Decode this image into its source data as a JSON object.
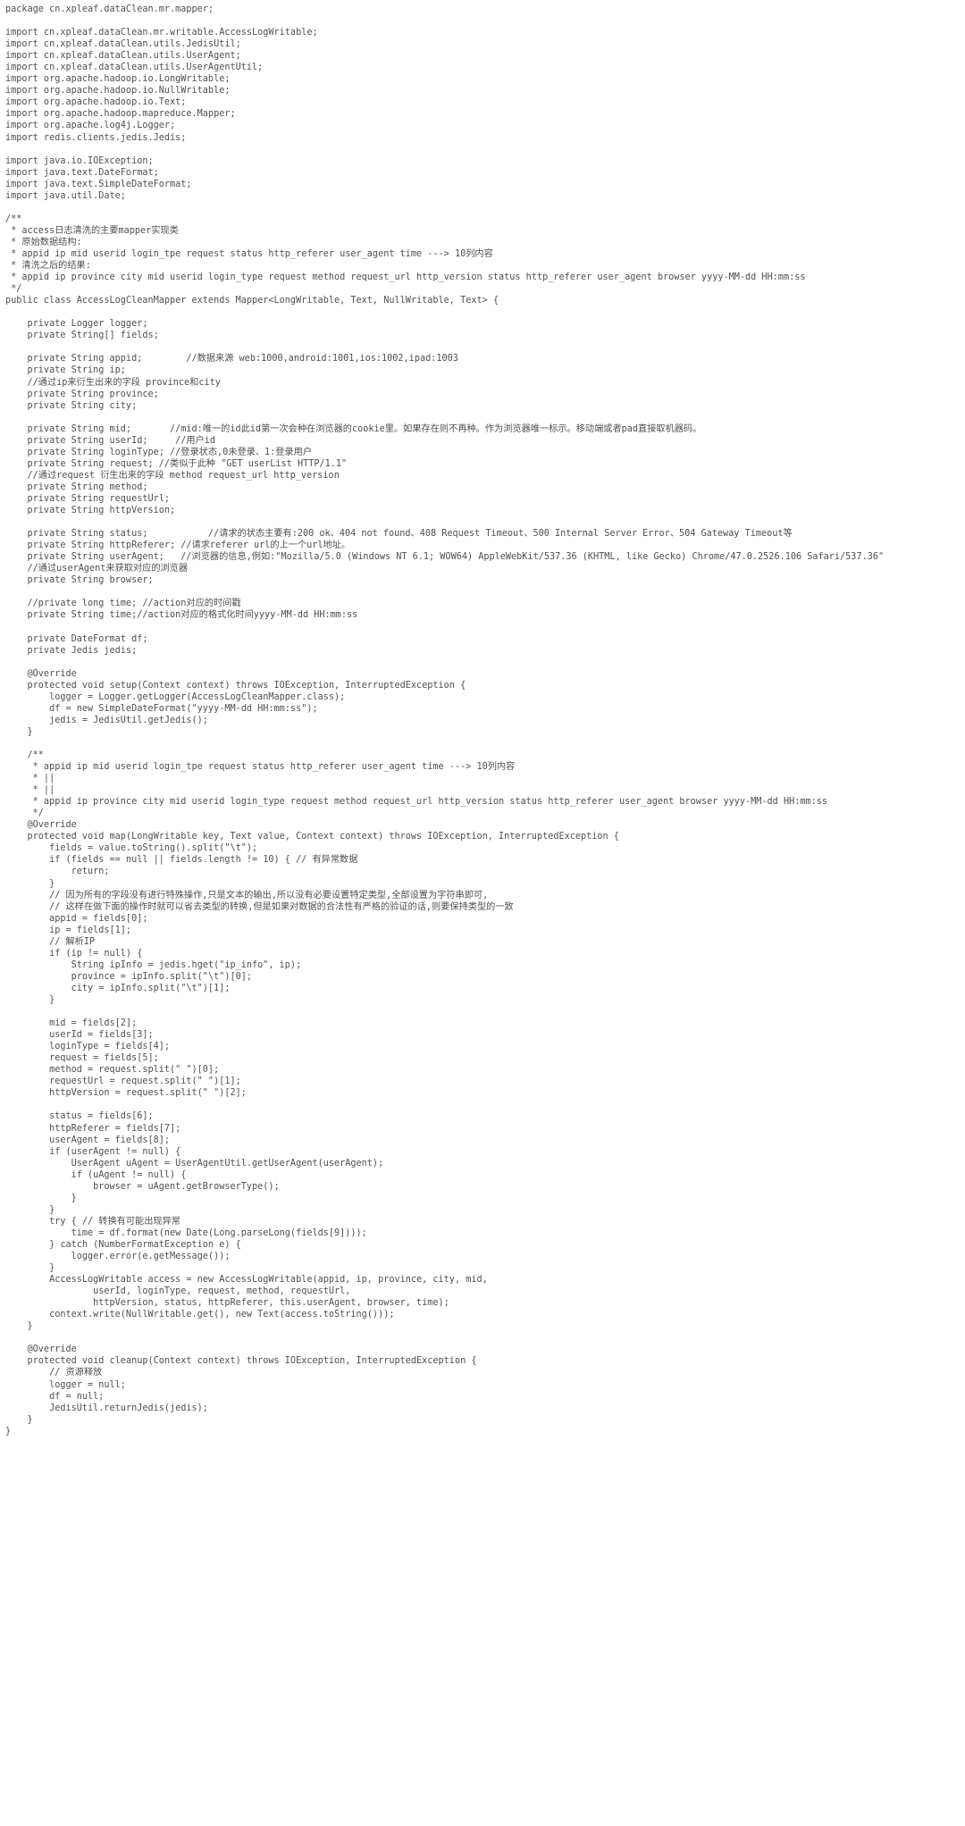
{
  "document": {
    "language": "java",
    "class_name": "AccessLogCleanMapper",
    "package": "cn.xpleaf.dataClean.mr.mapper",
    "background_color": "#ffffff",
    "text_color": "#4f4f4f"
  },
  "code": {
    "lines": [
      "package cn.xpleaf.dataClean.mr.mapper;",
      "",
      "import cn.xpleaf.dataClean.mr.writable.AccessLogWritable;",
      "import cn.xpleaf.dataClean.utils.JedisUtil;",
      "import cn.xpleaf.dataClean.utils.UserAgent;",
      "import cn.xpleaf.dataClean.utils.UserAgentUtil;",
      "import org.apache.hadoop.io.LongWritable;",
      "import org.apache.hadoop.io.NullWritable;",
      "import org.apache.hadoop.io.Text;",
      "import org.apache.hadoop.mapreduce.Mapper;",
      "import org.apache.log4j.Logger;",
      "import redis.clients.jedis.Jedis;",
      "",
      "import java.io.IOException;",
      "import java.text.DateFormat;",
      "import java.text.SimpleDateFormat;",
      "import java.util.Date;",
      "",
      "/**",
      " * access日志清洗的主要mapper实现类",
      " * 原始数据结构:",
      " * appid ip mid userid login_tpe request status http_referer user_agent time ---> 10列内容",
      " * 清洗之后的结果:",
      " * appid ip province city mid userid login_type request method request_url http_version status http_referer user_agent browser yyyy-MM-dd HH:mm:ss",
      " */",
      "public class AccessLogCleanMapper extends Mapper<LongWritable, Text, NullWritable, Text> {",
      "",
      "    private Logger logger;",
      "    private String[] fields;",
      "",
      "    private String appid;        //数据来源 web:1000,android:1001,ios:1002,ipad:1003",
      "    private String ip;",
      "    //通过ip来衍生出来的字段 province和city",
      "    private String province;",
      "    private String city;",
      "",
      "    private String mid;       //mid:唯一的id此id第一次会种在浏览器的cookie里。如果存在则不再种。作为浏览器唯一标示。移动端或者pad直接取机器码。",
      "    private String userId;     //用户id",
      "    private String loginType; //登录状态,0未登录、1:登录用户",
      "    private String request; //类似于此种 \"GET userList HTTP/1.1\"",
      "    //通过request 衍生出来的字段 method request_url http_version",
      "    private String method;",
      "    private String requestUrl;",
      "    private String httpVersion;",
      "",
      "    private String status;           //请求的状态主要有:200 ok、404 not found、408 Request Timeout、500 Internal Server Error、504 Gateway Timeout等",
      "    private String httpReferer; //请求referer url的上一个url地址。",
      "    private String userAgent;   //浏览器的信息,例如:\"Mozilla/5.0 (Windows NT 6.1; WOW64) AppleWebKit/537.36 (KHTML, like Gecko) Chrome/47.0.2526.106 Safari/537.36\"",
      "    //通过userAgent来获取对应的浏览器",
      "    private String browser;",
      "",
      "    //private long time; //action对应的时间戳",
      "    private String time;//action对应的格式化时间yyyy-MM-dd HH:mm:ss",
      "",
      "    private DateFormat df;",
      "    private Jedis jedis;",
      "",
      "    @Override",
      "    protected void setup(Context context) throws IOException, InterruptedException {",
      "        logger = Logger.getLogger(AccessLogCleanMapper.class);",
      "        df = new SimpleDateFormat(\"yyyy-MM-dd HH:mm:ss\");",
      "        jedis = JedisUtil.getJedis();",
      "    }",
      "",
      "    /**",
      "     * appid ip mid userid login_tpe request status http_referer user_agent time ---> 10列内容",
      "     * ||",
      "     * ||",
      "     * appid ip province city mid userid login_type request method request_url http_version status http_referer user_agent browser yyyy-MM-dd HH:mm:ss",
      "     */",
      "    @Override",
      "    protected void map(LongWritable key, Text value, Context context) throws IOException, InterruptedException {",
      "        fields = value.toString().split(\"\\t\");",
      "        if (fields == null || fields.length != 10) { // 有异常数据",
      "            return;",
      "        }",
      "        // 因为所有的字段没有进行特殊操作,只是文本的输出,所以没有必要设置特定类型,全部设置为字符串即可,",
      "        // 这样在做下面的操作时就可以省去类型的转换,但是如果对数据的合法性有严格的验证的话,则要保持类型的一致",
      "        appid = fields[0];",
      "        ip = fields[1];",
      "        // 解析IP",
      "        if (ip != null) {",
      "            String ipInfo = jedis.hget(\"ip_info\", ip);",
      "            province = ipInfo.split(\"\\t\")[0];",
      "            city = ipInfo.split(\"\\t\")[1];",
      "        }",
      "",
      "        mid = fields[2];",
      "        userId = fields[3];",
      "        loginType = fields[4];",
      "        request = fields[5];",
      "        method = request.split(\" \")[0];",
      "        requestUrl = request.split(\" \")[1];",
      "        httpVersion = request.split(\" \")[2];",
      "",
      "        status = fields[6];",
      "        httpReferer = fields[7];",
      "        userAgent = fields[8];",
      "        if (userAgent != null) {",
      "            UserAgent uAgent = UserAgentUtil.getUserAgent(userAgent);",
      "            if (uAgent != null) {",
      "                browser = uAgent.getBrowserType();",
      "            }",
      "        }",
      "        try { // 转换有可能出现异常",
      "            time = df.format(new Date(Long.parseLong(fields[9])));",
      "        } catch (NumberFormatException e) {",
      "            logger.error(e.getMessage());",
      "        }",
      "        AccessLogWritable access = new AccessLogWritable(appid, ip, province, city, mid,",
      "                userId, loginType, request, method, requestUrl,",
      "                httpVersion, status, httpReferer, this.userAgent, browser, time);",
      "        context.write(NullWritable.get(), new Text(access.toString()));",
      "    }",
      "",
      "    @Override",
      "    protected void cleanup(Context context) throws IOException, InterruptedException {",
      "        // 资源释放",
      "        logger = null;",
      "        df = null;",
      "        JedisUtil.returnJedis(jedis);",
      "    }",
      "}"
    ]
  }
}
